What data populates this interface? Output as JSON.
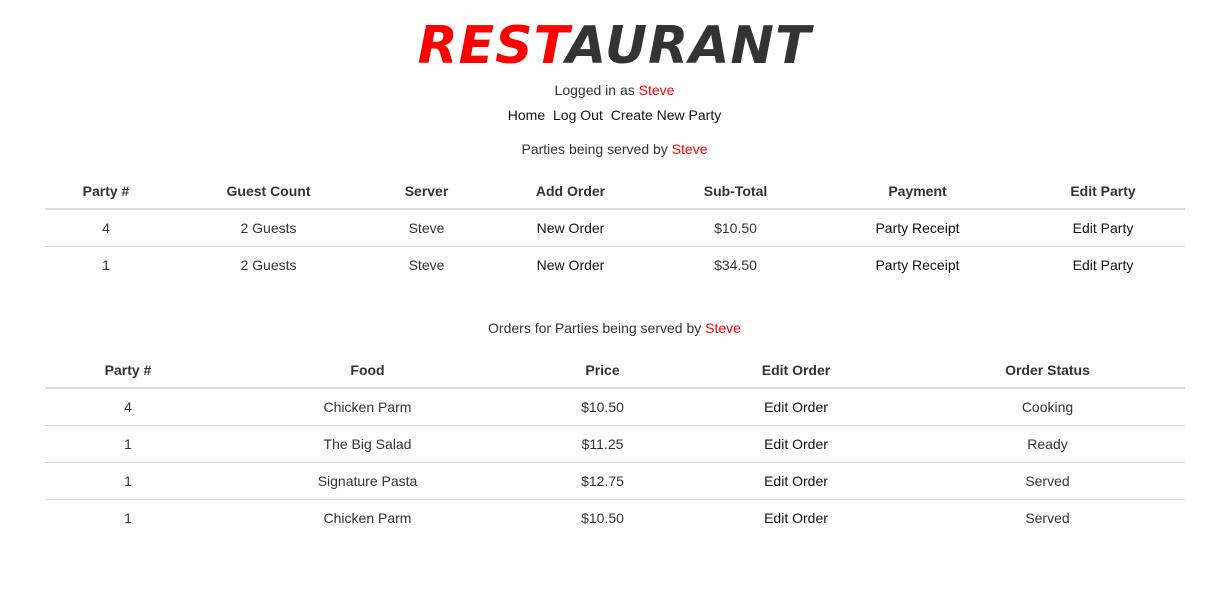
{
  "logo": {
    "part1": "REST",
    "part2": "aurant"
  },
  "login": {
    "prefix": "Logged in as",
    "user": "Steve"
  },
  "nav": {
    "home": "Home",
    "logout": "Log Out",
    "create": "Create New Party"
  },
  "parties": {
    "caption_prefix": "Parties being served by",
    "caption_user": "Steve",
    "headers": [
      "Party #",
      "Guest Count",
      "Server",
      "Add Order",
      "Sub-Total",
      "Payment",
      "Edit Party"
    ],
    "rows": [
      {
        "party": "4",
        "guests": "2 Guests",
        "server": "Steve",
        "add_order": "New Order",
        "subtotal": "$10.50",
        "payment": "Party Receipt",
        "edit": "Edit Party"
      },
      {
        "party": "1",
        "guests": "2 Guests",
        "server": "Steve",
        "add_order": "New Order",
        "subtotal": "$34.50",
        "payment": "Party Receipt",
        "edit": "Edit Party"
      }
    ]
  },
  "orders": {
    "caption_prefix": "Orders for Parties being served by",
    "caption_user": "Steve",
    "headers": [
      "Party #",
      "Food",
      "Price",
      "Edit Order",
      "Order Status"
    ],
    "rows": [
      {
        "party": "4",
        "food": "Chicken Parm",
        "price": "$10.50",
        "edit": "Edit Order",
        "status": "Cooking"
      },
      {
        "party": "1",
        "food": "The Big Salad",
        "price": "$11.25",
        "edit": "Edit Order",
        "status": "Ready"
      },
      {
        "party": "1",
        "food": "Signature Pasta",
        "price": "$12.75",
        "edit": "Edit Order",
        "status": "Served"
      },
      {
        "party": "1",
        "food": "Chicken Parm",
        "price": "$10.50",
        "edit": "Edit Order",
        "status": "Served"
      }
    ]
  },
  "colors": {
    "accent": "#ff0000",
    "text": "#333333",
    "border": "#dddddd"
  }
}
